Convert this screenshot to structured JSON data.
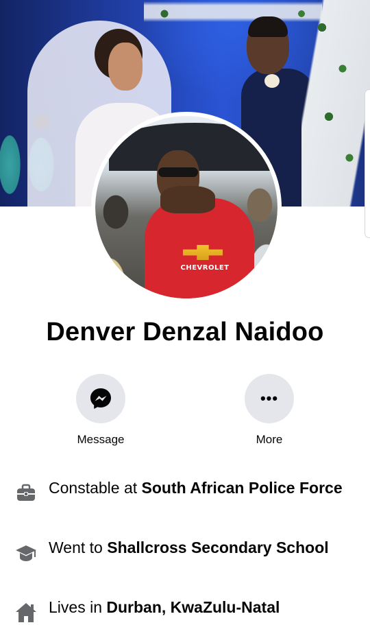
{
  "profile": {
    "name": "Denver Denzal Naidoo",
    "shirt_print": "CHEVROLET"
  },
  "actions": [
    {
      "label": "Message",
      "icon": "messenger-icon"
    },
    {
      "label": "More",
      "icon": "more-dots-icon"
    }
  ],
  "intro": {
    "work": {
      "prefix": "Constable at ",
      "place": "South African Police Force",
      "icon": "briefcase-icon"
    },
    "education": {
      "prefix": "Went to ",
      "place": "Shallcross Secondary School",
      "icon": "graduation-cap-icon"
    },
    "residence": {
      "prefix": "Lives in ",
      "place": "Durban, KwaZulu-Natal",
      "icon": "home-icon"
    }
  },
  "colors": {
    "button_bg": "#e4e6eb",
    "icon_gray": "#65676b",
    "text": "#050505"
  }
}
